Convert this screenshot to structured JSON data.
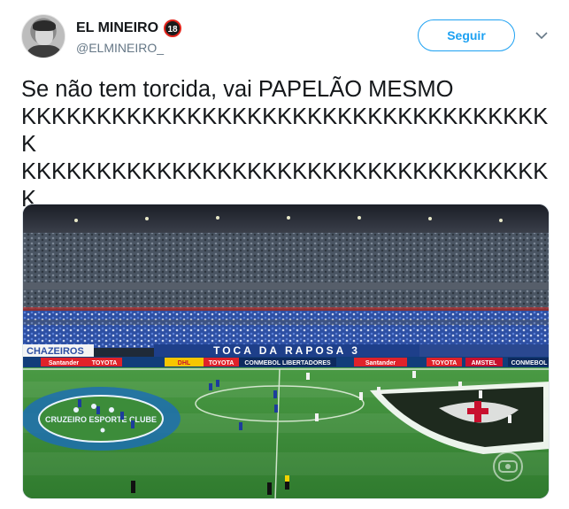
{
  "tweet": {
    "display_name": "EL MINEIRO",
    "age_badge": "18",
    "handle": "@ELMINEIRO_",
    "follow_label": "Seguir",
    "text": "Se não tem torcida, vai PAPELÃO MESMO\nKKKKKKKKKKKKKKKKKKKKKKKKKKKKKKKKKKKK\nKKKKKKKKKKKKKKKKKKKKKKKKKKKKKKKKKKKK\nKKKKKKKKKKKKKK"
  },
  "media": {
    "stand_banner": "TOCA DA RAPOSA 3",
    "ad_boards": [
      "Santander",
      "TOYOTA",
      "DHL",
      "TOYOTA",
      "CONMEBOL LIBERTADORES",
      "Santander",
      "TOYOTA",
      "AMSTEL",
      "CONMEBOL"
    ],
    "left_crest_text": "CRUZEIRO ESPORTE CLUBE",
    "left_banner": "CHAZEIROS",
    "broadcaster_icon": "globo-icon",
    "colors": {
      "pitch": "#3c8c3a",
      "stands_blue": "#2d4fa3",
      "follow_blue": "#1da1f2"
    }
  }
}
